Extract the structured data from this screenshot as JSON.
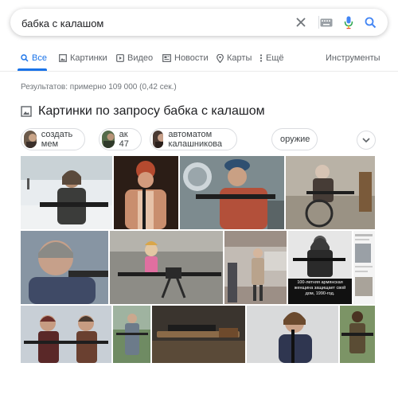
{
  "search": {
    "query": "бабка с калашом",
    "icons": [
      "close-icon",
      "keyboard-icon",
      "microphone-icon",
      "search-icon"
    ]
  },
  "tabs": [
    {
      "label": "Все",
      "icon": "search-icon",
      "active": true
    },
    {
      "label": "Картинки",
      "icon": "image-icon",
      "active": false
    },
    {
      "label": "Видео",
      "icon": "video-icon",
      "active": false
    },
    {
      "label": "Новости",
      "icon": "news-icon",
      "active": false
    },
    {
      "label": "Карты",
      "icon": "map-pin-icon",
      "active": false
    },
    {
      "label": "Ещё",
      "icon": "more-icon",
      "active": false
    }
  ],
  "tools_label": "Инструменты",
  "result_stats": "Результатов: примерно 109 000 (0,42 сек.)",
  "images_section": {
    "title": "Картинки по запросу бабка с калашом",
    "chips": [
      {
        "label": "создать мем"
      },
      {
        "label": "ак 47"
      },
      {
        "label": "автоматом калашникова"
      },
      {
        "label": "оружие"
      }
    ],
    "caption_text": "100-летняя армянская женщина защищает свой дом, 1990-год."
  },
  "colors": {
    "accent": "#1a73e8",
    "text_secondary": "#70757a",
    "border": "#dadce0"
  }
}
